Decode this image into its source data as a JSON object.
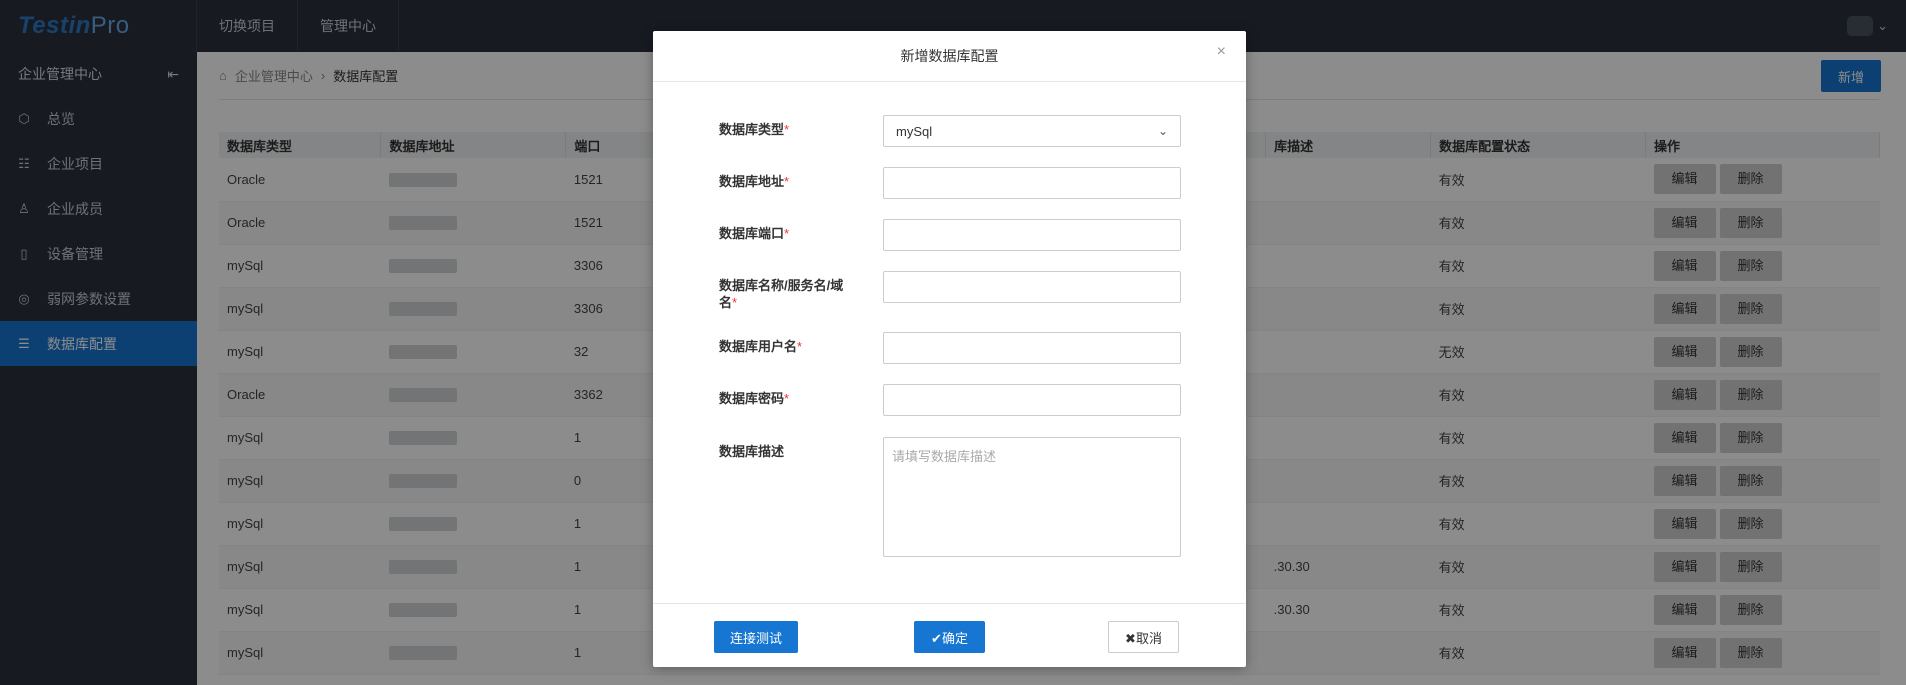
{
  "app": {
    "logo_main": "Testin",
    "logo_pro": "Pro"
  },
  "topnav": [
    {
      "label": "切换项目"
    },
    {
      "label": "管理中心"
    }
  ],
  "sidebar": {
    "title": "企业管理中心",
    "items": [
      {
        "label": "总览",
        "icon": "cube-icon"
      },
      {
        "label": "企业项目",
        "icon": "list-icon"
      },
      {
        "label": "企业成员",
        "icon": "user-icon"
      },
      {
        "label": "设备管理",
        "icon": "phone-icon"
      },
      {
        "label": "弱网参数设置",
        "icon": "network-icon"
      },
      {
        "label": "数据库配置",
        "icon": "database-icon",
        "active": true
      }
    ]
  },
  "breadcrumb": {
    "home": "企业管理中心",
    "current": "数据库配置"
  },
  "toolbar": {
    "add_label": "新增"
  },
  "table": {
    "headers": [
      "数据库类型",
      "数据库地址",
      "端口",
      "",
      "库描述",
      "数据库配置状态",
      "操作"
    ],
    "edit_label": "编辑",
    "delete_label": "删除",
    "rows": [
      {
        "type": "Oracle",
        "port": "1521",
        "desc": "",
        "status": "有效"
      },
      {
        "type": "Oracle",
        "port": "1521",
        "desc": "",
        "status": "有效"
      },
      {
        "type": "mySql",
        "port": "3306",
        "desc": "",
        "status": "有效"
      },
      {
        "type": "mySql",
        "port": "3306",
        "desc": "",
        "status": "有效"
      },
      {
        "type": "mySql",
        "port": "32",
        "desc": "",
        "status": "无效"
      },
      {
        "type": "Oracle",
        "port": "3362",
        "desc": "",
        "status": "有效"
      },
      {
        "type": "mySql",
        "port": "1",
        "desc": "",
        "status": "有效"
      },
      {
        "type": "mySql",
        "port": "0",
        "desc": "",
        "status": "有效"
      },
      {
        "type": "mySql",
        "port": "1",
        "desc": "",
        "status": "有效"
      },
      {
        "type": "mySql",
        "port": "1",
        "desc": ".30.30",
        "status": "有效"
      },
      {
        "type": "mySql",
        "port": "1",
        "desc": ".30.30",
        "status": "有效"
      },
      {
        "type": "mySql",
        "port": "1",
        "desc": "",
        "status": "有效"
      }
    ]
  },
  "modal": {
    "title": "新增数据库配置",
    "close": "×",
    "fields": {
      "db_type_label": "数据库类型",
      "db_type_value": "mySql",
      "db_address_label": "数据库地址",
      "db_port_label": "数据库端口",
      "db_name_label": "数据库名称/服务名/域名",
      "db_user_label": "数据库用户名",
      "db_password_label": "数据库密码",
      "db_desc_label": "数据库描述",
      "db_desc_placeholder": "请填写数据库描述",
      "required_mark": "*"
    },
    "buttons": {
      "test": "连接测试",
      "confirm": "✔确定",
      "cancel": "✖取消"
    }
  }
}
